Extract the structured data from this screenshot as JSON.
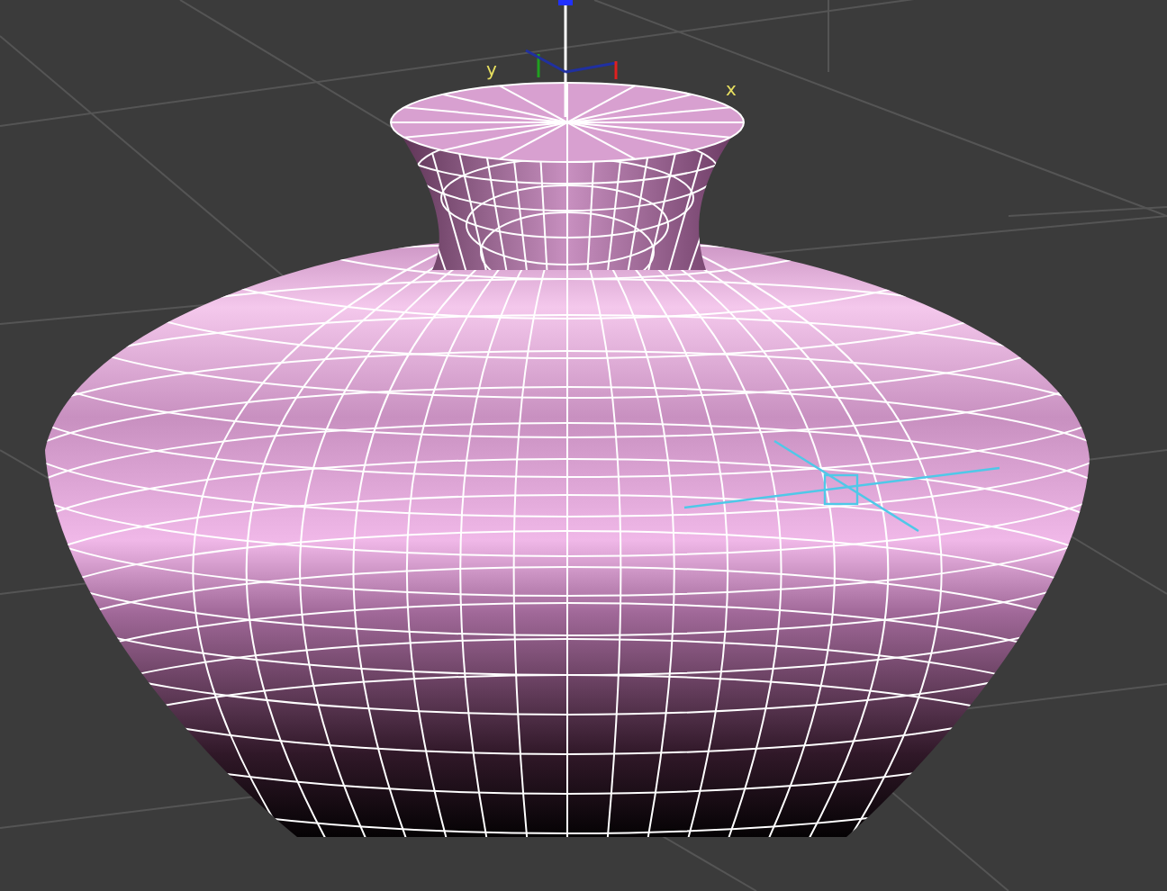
{
  "viewport": {
    "axis_labels": [
      {
        "label": "y"
      },
      {
        "label": "x"
      }
    ]
  }
}
